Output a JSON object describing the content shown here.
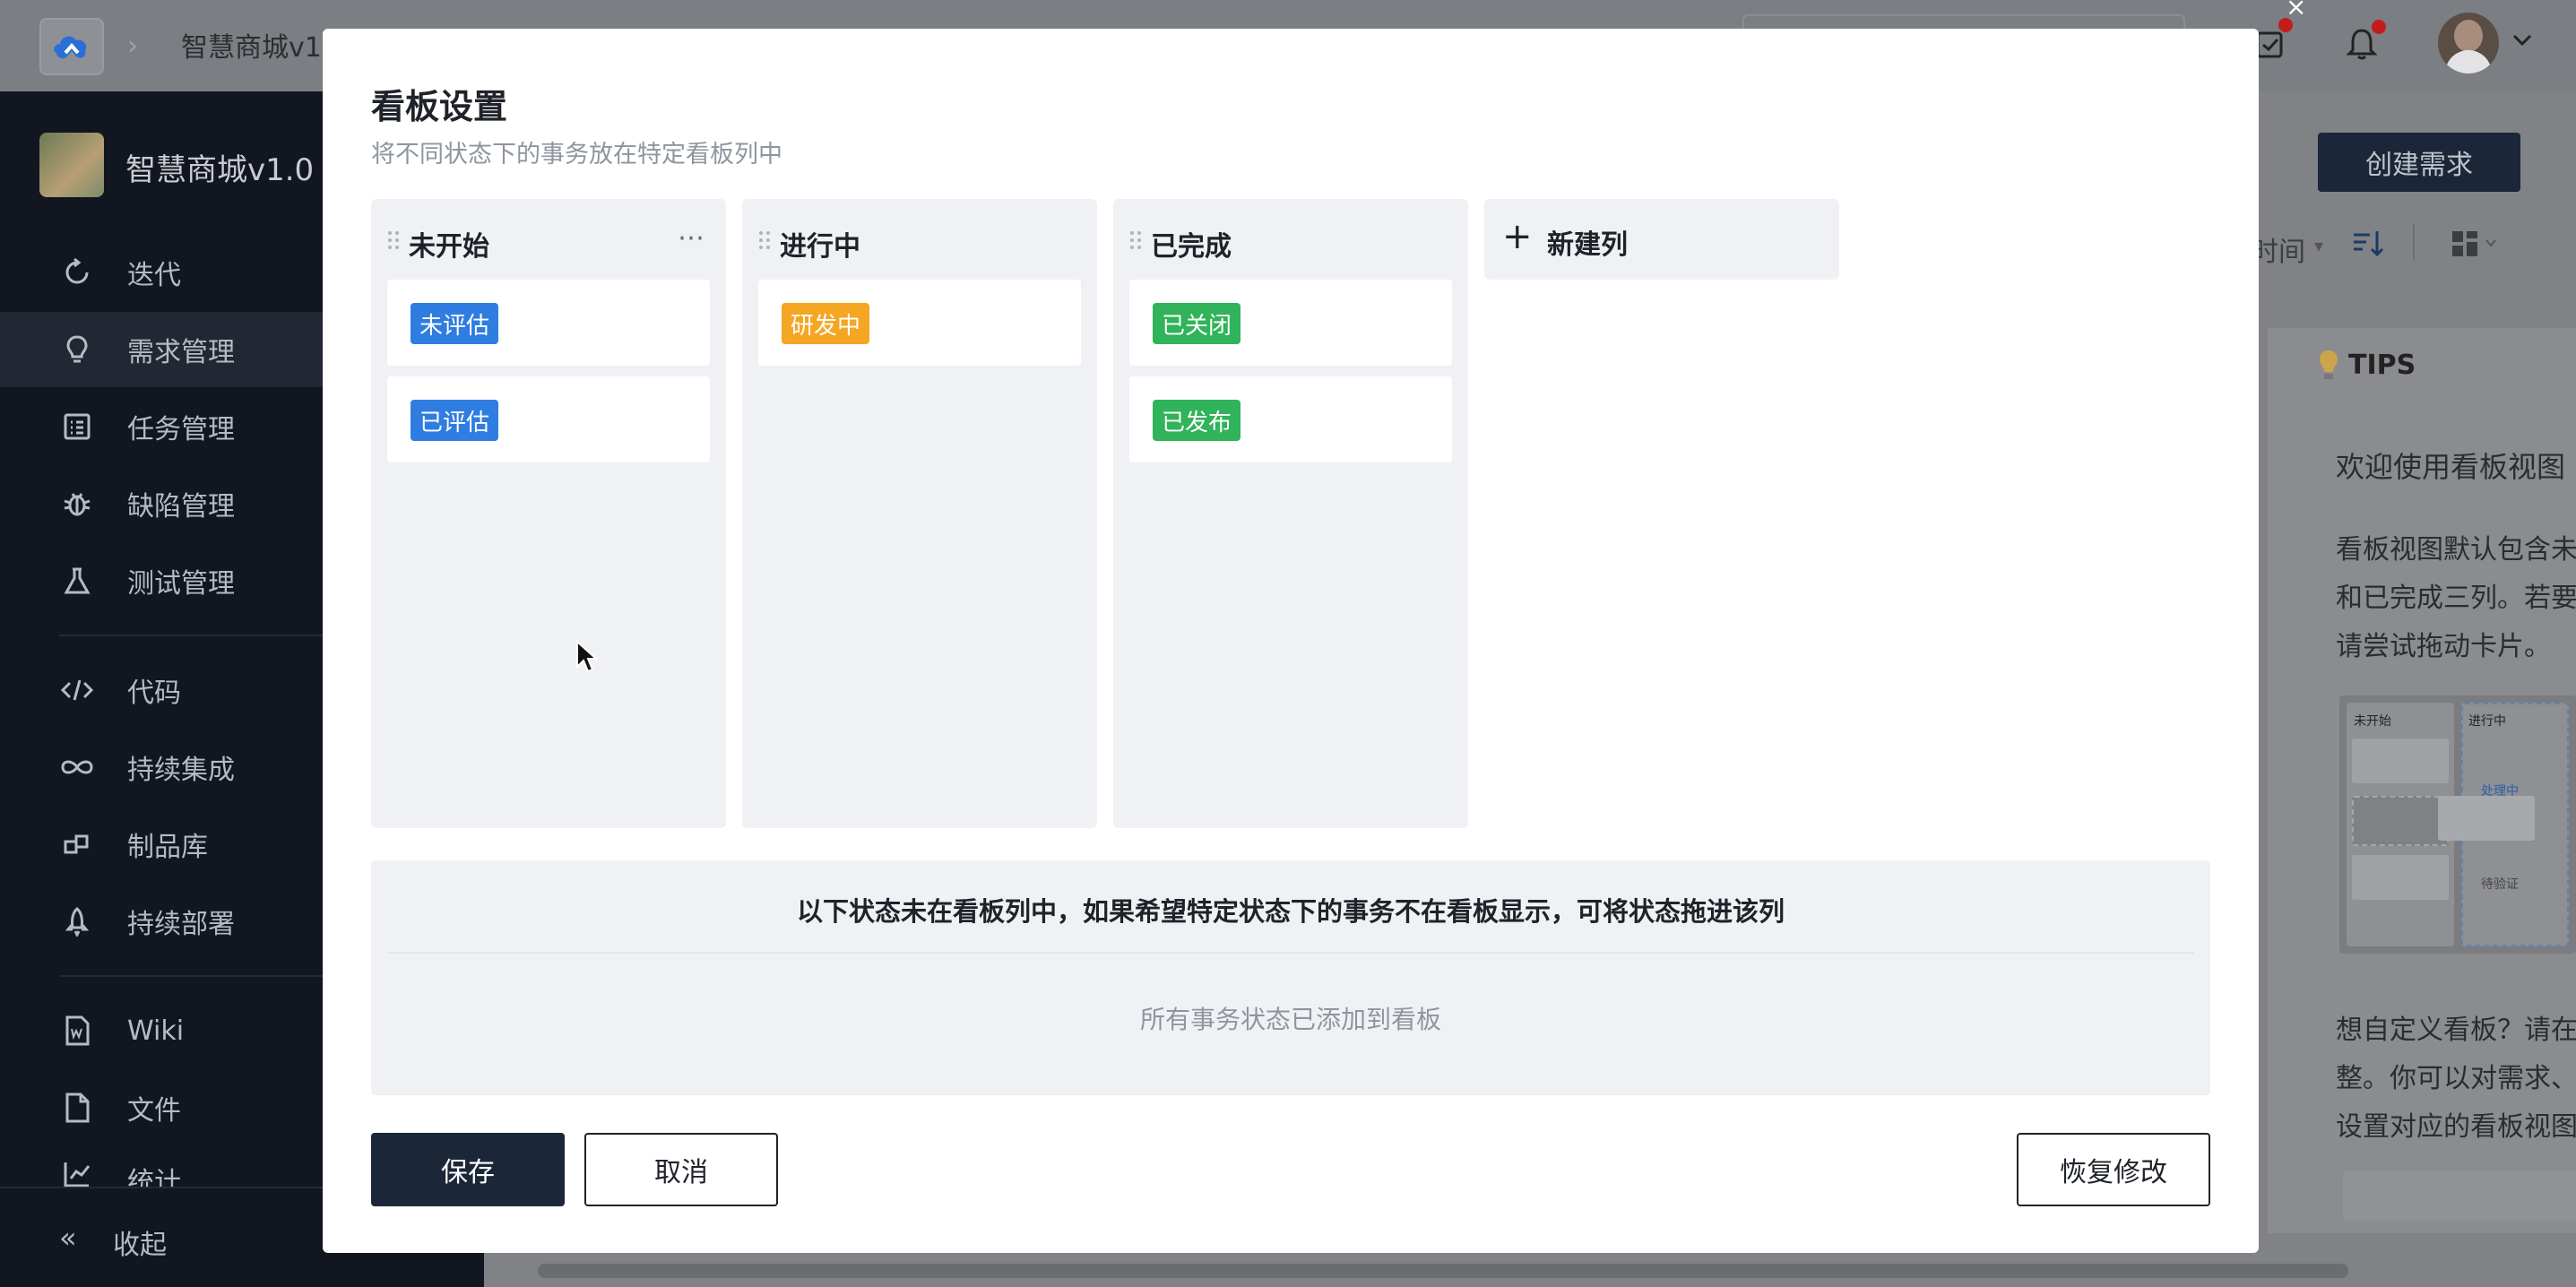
{
  "topbar": {
    "breadcrumb": "智慧商城v1"
  },
  "sidebar": {
    "project_name": "智慧商城v1.0",
    "items": [
      {
        "label": "迭代",
        "icon": "iteration-icon"
      },
      {
        "label": "需求管理",
        "icon": "lightbulb-icon",
        "active": true
      },
      {
        "label": "任务管理",
        "icon": "task-icon"
      },
      {
        "label": "缺陷管理",
        "icon": "bug-icon"
      },
      {
        "label": "测试管理",
        "icon": "flask-icon"
      },
      {
        "label": "代码",
        "icon": "code-icon"
      },
      {
        "label": "持续集成",
        "icon": "infinity-icon"
      },
      {
        "label": "制品库",
        "icon": "artifact-icon"
      },
      {
        "label": "持续部署",
        "icon": "rocket-icon"
      },
      {
        "label": "Wiki",
        "icon": "wiki-icon"
      },
      {
        "label": "文件",
        "icon": "file-icon"
      },
      {
        "label": "统计",
        "icon": "stats-icon"
      }
    ],
    "collapse_label": "收起"
  },
  "background": {
    "create_button": "创建需求",
    "sort_label": "时间",
    "tips": {
      "title": "TIPS",
      "heading": "欢迎使用看板视图",
      "body_lines": [
        "看板视图默认包含未",
        "和已完成三列。若要",
        "请尝试拖动卡片。"
      ],
      "footer_lines": [
        "想自定义看板？请在",
        "整。你可以对需求、",
        "设置对应的看板视图"
      ],
      "mini_board": {
        "col1": "未开始",
        "col2": "进行中",
        "tag": "处理中",
        "tag2": "待验证"
      }
    }
  },
  "modal": {
    "title": "看板设置",
    "subtitle": "将不同状态下的事务放在特定看板列中",
    "columns": [
      {
        "title": "未开始",
        "cards": [
          {
            "label": "未评估",
            "color": "#2f7de1"
          },
          {
            "label": "已评估",
            "color": "#2f7de1"
          }
        ]
      },
      {
        "title": "进行中",
        "cards": [
          {
            "label": "研发中",
            "color": "#f5a623"
          }
        ]
      },
      {
        "title": "已完成",
        "cards": [
          {
            "label": "已关闭",
            "color": "#30b35a"
          },
          {
            "label": "已发布",
            "color": "#30b35a"
          }
        ]
      }
    ],
    "new_column_label": "新建列",
    "unassigned": {
      "title": "以下状态未在看板列中，如果希望特定状态下的事务不在看板显示，可将状态拖进该列",
      "empty_text": "所有事务状态已添加到看板"
    },
    "buttons": {
      "save": "保存",
      "cancel": "取消",
      "restore": "恢复修改"
    }
  }
}
